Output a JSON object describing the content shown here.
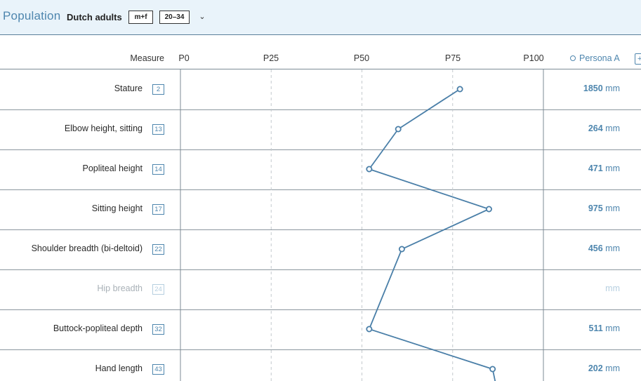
{
  "header": {
    "title": "Population",
    "population_name": "Dutch adults",
    "sex_chip": "m+f",
    "age_chip": "20–34",
    "dropdown_icon": "chevron-down-icon",
    "dropdown_glyph": "⌄"
  },
  "columns": {
    "measure_label": "Measure",
    "scale_labels": [
      "P0",
      "P25",
      "P50",
      "P75",
      "P100"
    ],
    "persona_label": "Persona A",
    "add_persona_glyph": "+"
  },
  "rows": [
    {
      "label": "Stature",
      "badge": "2",
      "value": "1850",
      "unit": "mm",
      "percentile": 77,
      "disabled": false
    },
    {
      "label": "Elbow height, sitting",
      "badge": "13",
      "value": "264",
      "unit": "mm",
      "percentile": 60,
      "disabled": false
    },
    {
      "label": "Popliteal height",
      "badge": "14",
      "value": "471",
      "unit": "mm",
      "percentile": 52,
      "disabled": false
    },
    {
      "label": "Sitting height",
      "badge": "17",
      "value": "975",
      "unit": "mm",
      "percentile": 85,
      "disabled": false
    },
    {
      "label": "Shoulder breadth (bi-deltoid)",
      "badge": "22",
      "value": "456",
      "unit": "mm",
      "percentile": 61,
      "disabled": false
    },
    {
      "label": "Hip breadth",
      "badge": "24",
      "value": "",
      "unit": "mm",
      "percentile": null,
      "disabled": true
    },
    {
      "label": "Buttock-popliteal depth",
      "badge": "32",
      "value": "511",
      "unit": "mm",
      "percentile": 52,
      "disabled": false
    },
    {
      "label": "Hand length",
      "badge": "43",
      "value": "202",
      "unit": "mm",
      "percentile": 86,
      "disabled": false
    }
  ],
  "colors": {
    "accent": "#4e86ae",
    "header_bg": "#e9f3fa",
    "line": "#4a7fa8",
    "grid": "#c4c9cd"
  }
}
